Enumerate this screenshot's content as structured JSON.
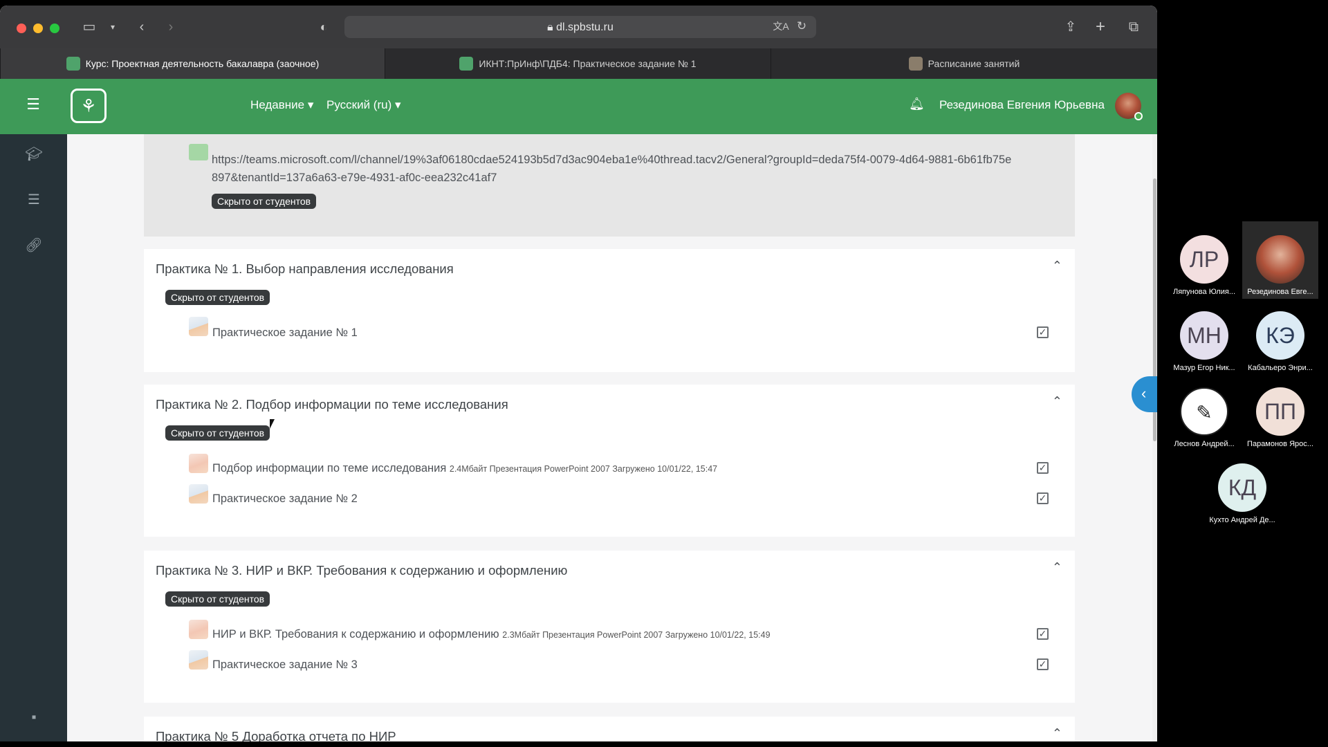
{
  "browser": {
    "url": "dl.spbstu.ru",
    "tabs": [
      {
        "label": "Курс: Проектная деятельность бакалавра (заочное)",
        "active": true
      },
      {
        "label": "ИКНТ:ПрИнф\\ПДБ4: Практическое задание № 1",
        "active": false
      },
      {
        "label": "Расписание занятий",
        "active": false
      }
    ]
  },
  "navbar": {
    "recent_label": "Недавние",
    "language_label": "Русский (ru)",
    "user_name": "Резединова Евгения Юрьевна"
  },
  "top_box": {
    "link": "https://teams.microsoft.com/l/channel/19%3af06180cdae524193b5d7d3ac904eba1e%40thread.tacv2/General?groupId=deda75f4-0079-4d64-9881-6b61fb75e897&tenantId=137a6a63-e79e-4931-af0c-eea232c41af7",
    "badge": "Скрыто от студентов"
  },
  "sections": [
    {
      "title": "Практика № 1. Выбор направления исследования",
      "badge": "Скрыто от студентов",
      "activities": [
        {
          "name": "Практическое задание № 1",
          "meta": ""
        }
      ]
    },
    {
      "title": "Практика № 2. Подбор информации по теме исследования",
      "badge": "Скрыто от студентов",
      "activities": [
        {
          "name": "Подбор информации по теме исследования",
          "meta": "2.4Мбайт Презентация PowerPoint 2007 Загружено 10/01/22, 15:47"
        },
        {
          "name": "Практическое задание № 2",
          "meta": ""
        }
      ]
    },
    {
      "title": "Практика № 3. НИР и ВКР. Требования к содержанию и оформлению",
      "badge": "Скрыто от студентов",
      "activities": [
        {
          "name": "НИР и ВКР. Требования к содержанию и оформлению",
          "meta": "2.3Мбайт Презентация PowerPoint 2007 Загружено 10/01/22, 15:49"
        },
        {
          "name": "Практическое задание № 3",
          "meta": ""
        }
      ]
    },
    {
      "title": "Практика № 5 Доработка отчета по НИР"
    }
  ],
  "participants": [
    {
      "initials": "ЛР",
      "name": "Ляпунова Юлия...",
      "color": "#f3dfe0"
    },
    {
      "initials": "",
      "name": "Резединова Евге...",
      "color": "#b0523a"
    },
    {
      "initials": "МН",
      "name": "Мазур Егор Ник...",
      "color": "#e3dfee"
    },
    {
      "initials": "КЭ",
      "name": "Кабальеро Энри...",
      "color": "#dcebf5"
    },
    {
      "initials": "",
      "name": "Леснов Андрей...",
      "color": "#ffffff"
    },
    {
      "initials": "ПП",
      "name": "Парамонов Ярос...",
      "color": "#f1e0d8"
    },
    {
      "initials": "КД",
      "name": "Кухто Андрей Де...",
      "color": "#dff0ee"
    }
  ],
  "icons": {
    "sidebar_toggle": "sidebar-icon",
    "back": "chevron-left-icon",
    "forward": "chevron-right-icon",
    "shield": "shield-icon",
    "lock": "lock-icon",
    "translate": "translate-icon",
    "reload": "reload-icon",
    "share": "share-icon",
    "new_tab": "plus-icon",
    "tab_overview": "tabs-icon",
    "hamburger": "hamburger-icon",
    "bell": "bell-icon",
    "chevron_up": "chevron-up-icon",
    "check": "checkbox-checked-icon"
  },
  "colors": {
    "brand_green": "#3e9a58",
    "drawer": "#263238",
    "badge_bg": "#373a3c",
    "collapse_button": "#2a8fd1"
  }
}
